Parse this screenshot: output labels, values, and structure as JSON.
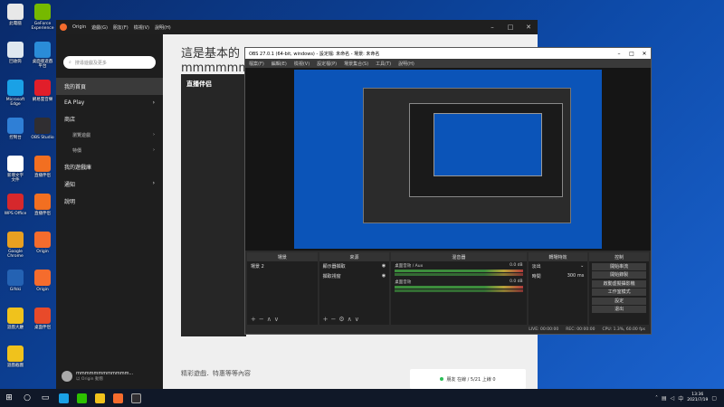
{
  "desktop": {
    "icons": [
      {
        "label": "此電腦",
        "color": "#e8e8e8"
      },
      {
        "label": "GeForce\nExperience",
        "color": "#76b900"
      },
      {
        "label": "回收筒",
        "color": "#dfe8f0"
      },
      {
        "label": "桌面版遊戲\n平台",
        "color": "#2a8cd8"
      },
      {
        "label": "Microsoft\nEdge",
        "color": "#1aa1e6"
      },
      {
        "label": "網易雲音樂",
        "color": "#e11e2a"
      },
      {
        "label": "控制台",
        "color": "#2f7fd6"
      },
      {
        "label": "OBS Studio",
        "color": "#302e31"
      },
      {
        "label": "新增文字\n文件",
        "color": "#ffffff"
      },
      {
        "label": "直播伴侣",
        "color": "#f26f21"
      },
      {
        "label": "WPS Office",
        "color": "#d6282c"
      },
      {
        "label": "直播伴侣",
        "color": "#f26f21"
      },
      {
        "label": "Google\nChrome",
        "color": "#e8a021"
      },
      {
        "label": "Origin",
        "color": "#f56c2d"
      },
      {
        "label": "Gifski",
        "color": "#2462b3"
      },
      {
        "label": "Origin",
        "color": "#f56c2d"
      },
      {
        "label": "遊戲大廳",
        "color": "#f0c21c"
      },
      {
        "label": "桌面伴侶",
        "color": "#e84a2a"
      },
      {
        "label": "遊戲截圖",
        "color": "#f0c21c"
      }
    ]
  },
  "origin": {
    "menu": [
      "Origin",
      "遊戲(G)",
      "朋友(F)",
      "檢視(V)",
      "說明(H)"
    ],
    "search_placeholder": "搜尋遊戲及更多",
    "nav": [
      {
        "label": "我的首頁",
        "active": true,
        "chevron": ""
      },
      {
        "label": "EA Play",
        "active": false,
        "chevron": "›"
      },
      {
        "label": "商店",
        "active": false,
        "chevron": ""
      },
      {
        "label": "瀏覽遊戲",
        "active": false,
        "chevron": "›",
        "sub": true
      },
      {
        "label": "特價",
        "active": false,
        "chevron": "›",
        "sub": true
      },
      {
        "label": "我的遊戲庫",
        "active": false,
        "chevron": ""
      },
      {
        "label": "通知",
        "active": false,
        "chevron": "›"
      },
      {
        "label": "說明",
        "active": false,
        "chevron": ""
      }
    ],
    "heading_line1": "這是基本的",
    "heading_line2": "mmmmmm",
    "bottom_text": "精彩遊戲．特惠等等內容",
    "user_name": "mmmmmmmmmmmm...",
    "user_status": "以 Origin 動態"
  },
  "zb": {
    "logo": "直播伴侣"
  },
  "obs": {
    "title": "OBS 27.0.1 (64-bit, windows) - 設定檔: 未命名 - 場景: 未命名",
    "menu": [
      "檔案(F)",
      "編輯(E)",
      "檢視(V)",
      "設定檔(P)",
      "場景集合(S)",
      "工具(T)",
      "說明(H)"
    ],
    "docks": {
      "scenes": {
        "title": "場景",
        "items": [
          "場景 2"
        ]
      },
      "sources": {
        "title": "來源",
        "items": [
          "顯示器擷取",
          "擷取視窗"
        ]
      },
      "mixer": {
        "title": "混音器",
        "rows": [
          {
            "label": "桌面音效 / Aux",
            "value": "0.0 dB"
          },
          {
            "label": "桌面音效",
            "value": "0.0 dB"
          }
        ]
      },
      "transitions": {
        "title": "轉場特效",
        "type": "淡出",
        "duration_label": "時間",
        "duration": "300 ms"
      },
      "controls": {
        "title": "控制",
        "buttons": [
          "開始串流",
          "開始錄製",
          "啟動虛擬攝影機",
          "工作室模式",
          "設定",
          "退出"
        ]
      }
    },
    "status": [
      "LIVE: 00:00:00",
      "REC: 00:00:00",
      "CPU: 1.3%, 60.00 fps"
    ]
  },
  "notification": {
    "text": "朋友 在線 / 5/21 上線 0"
  },
  "taskbar": {
    "time": "13:36",
    "date": "2021/7/19",
    "lang": "中"
  }
}
